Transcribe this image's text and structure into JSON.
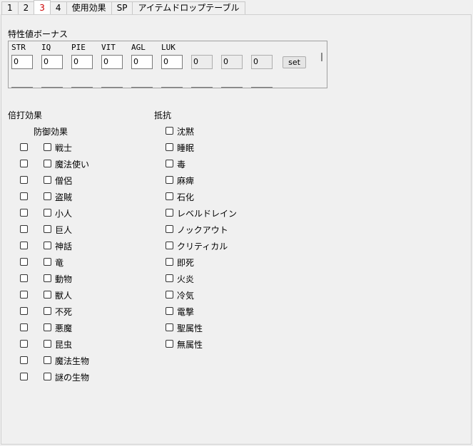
{
  "tabs": [
    "1",
    "2",
    "3",
    "4",
    "使用効果",
    "SP",
    "アイテムドロップテーブル"
  ],
  "active_tab_index": 2,
  "stat_bonus": {
    "title": "特性値ボーナス",
    "labels": [
      "STR",
      "IQ",
      "PIE",
      "VIT",
      "AGL",
      "LUK"
    ],
    "values": [
      "0",
      "0",
      "0",
      "0",
      "0",
      "0",
      "0",
      "0",
      "0"
    ],
    "set_label": "set"
  },
  "multiplier_title": "倍打効果",
  "defense_title": "防御効果",
  "resistance_title": "抵抗",
  "races": [
    "戦士",
    "魔法使い",
    "僧侶",
    "盗賊",
    "小人",
    "巨人",
    "神話",
    "竜",
    "動物",
    "獣人",
    "不死",
    "悪魔",
    "昆虫",
    "魔法生物",
    "謎の生物"
  ],
  "resistances": [
    "沈黙",
    "睡眠",
    "毒",
    "麻痺",
    "石化",
    "レベルドレイン",
    "ノックアウト",
    "クリティカル",
    "即死",
    "火炎",
    "冷気",
    "電撃",
    "聖属性",
    "無属性"
  ]
}
